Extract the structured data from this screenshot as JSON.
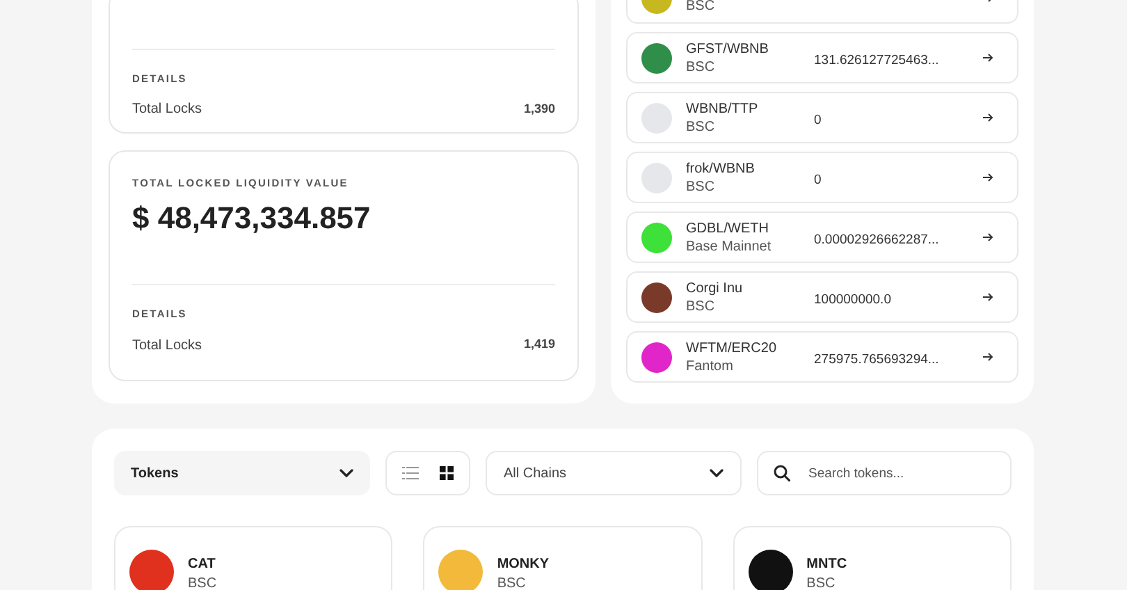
{
  "stats": [
    {
      "details_label": "DETAILS",
      "row_label": "Total Locks",
      "row_value": "1,390"
    },
    {
      "label": "TOTAL LOCKED LIQUIDITY VALUE",
      "value": "$ 48,473,334.857",
      "details_label": "DETAILS",
      "row_label": "Total Locks",
      "row_value": "1,419"
    }
  ],
  "pairs": [
    {
      "chain": "BSC",
      "color": "#c8b820"
    },
    {
      "name": "GFST/WBNB",
      "chain": "BSC",
      "amount": "131.626127725463...",
      "color": "#2f8f4a"
    },
    {
      "name": "WBNB/TTP",
      "chain": "BSC",
      "amount": "0",
      "color": "#e5e7eb"
    },
    {
      "name": "frok/WBNB",
      "chain": "BSC",
      "amount": "0",
      "color": "#e5e7eb"
    },
    {
      "name": "GDBL/WETH",
      "chain": "Base Mainnet",
      "amount": "0.00002926662287...",
      "color": "#3ee03a"
    },
    {
      "name": "Corgi Inu",
      "chain": "BSC",
      "amount": "100000000.0",
      "color": "#7a3a2a"
    },
    {
      "name": "WFTM/ERC20",
      "chain": "Fantom",
      "amount": "275975.765693294...",
      "color": "#e026c8"
    }
  ],
  "filters": {
    "type": "Tokens",
    "views": [
      {
        "kind": "list",
        "selected": false
      },
      {
        "kind": "grid",
        "selected": true
      }
    ],
    "chain": "All Chains",
    "search": {
      "placeholder": "Search tokens..."
    }
  },
  "tokens": [
    {
      "name": "CAT",
      "chain": "BSC",
      "color": "#e0301e"
    },
    {
      "name": "MONKY",
      "chain": "BSC",
      "color": "#f2b93b"
    },
    {
      "name": "MNTC",
      "chain": "BSC",
      "color": "#111111"
    }
  ]
}
